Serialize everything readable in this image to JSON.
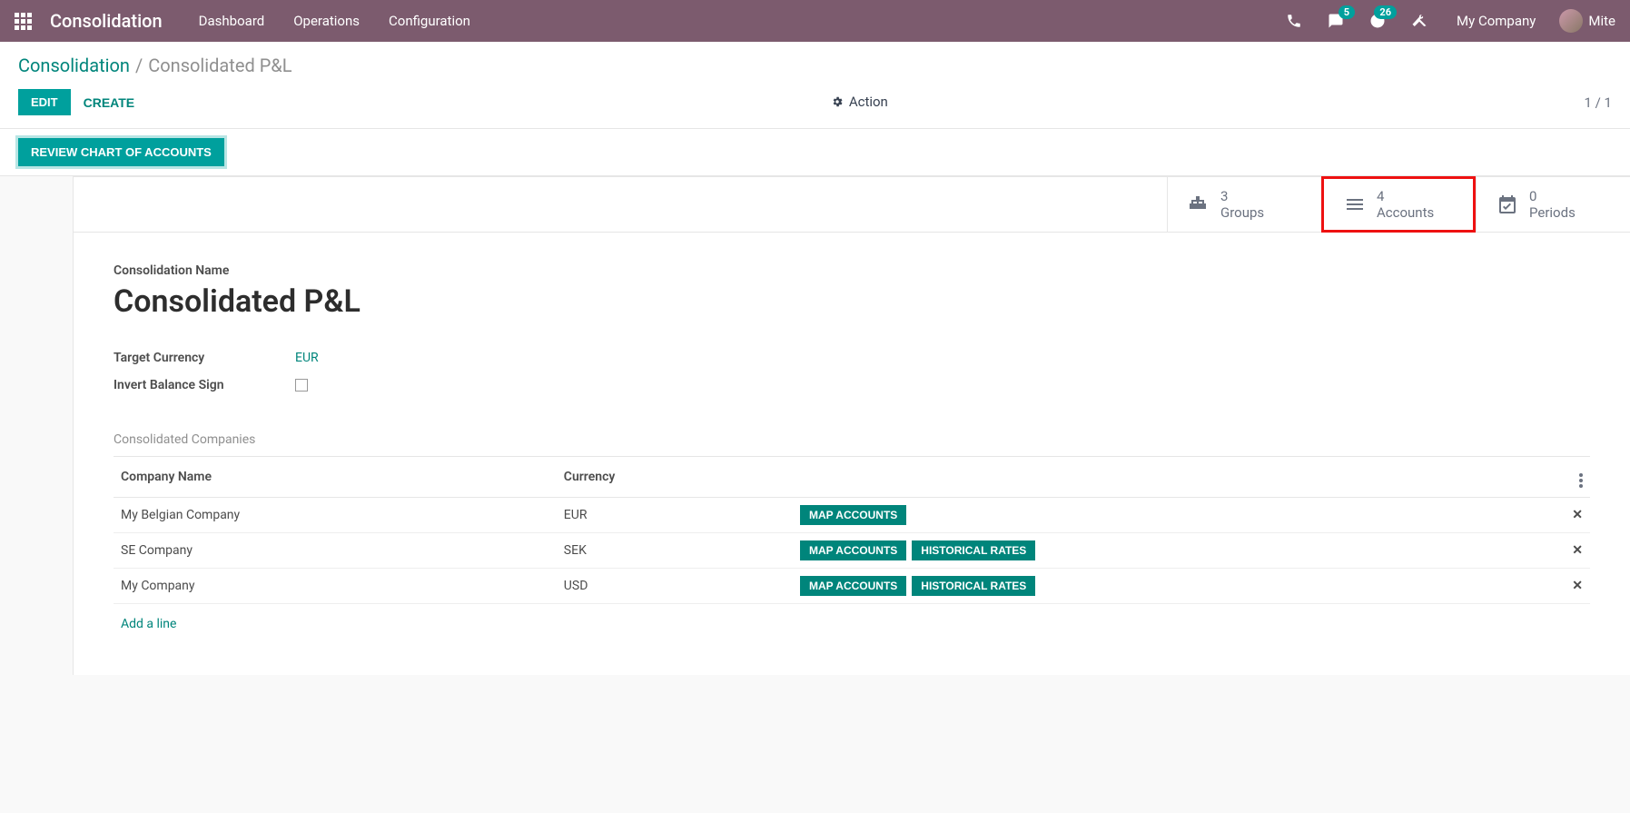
{
  "topnav": {
    "brand": "Consolidation",
    "links": [
      "Dashboard",
      "Operations",
      "Configuration"
    ],
    "msg_badge": "5",
    "activity_badge": "26",
    "company": "My Company",
    "username": "Mite"
  },
  "breadcrumb": {
    "root": "Consolidation",
    "sep": "/",
    "current": "Consolidated P&L"
  },
  "action_bar": {
    "edit": "EDIT",
    "create": "CREATE",
    "action": "Action",
    "pager": "1 / 1"
  },
  "status_bar": {
    "review": "REVIEW CHART OF ACCOUNTS"
  },
  "stats": {
    "groups": {
      "count": "3",
      "label": "Groups"
    },
    "accounts": {
      "count": "4",
      "label": "Accounts"
    },
    "periods": {
      "count": "0",
      "label": "Periods"
    }
  },
  "form": {
    "name_label": "Consolidation Name",
    "name": "Consolidated P&L",
    "currency_label": "Target Currency",
    "currency_value": "EUR",
    "invert_label": "Invert Balance Sign",
    "section_title": "Consolidated Companies",
    "col_company": "Company Name",
    "col_currency": "Currency",
    "rows": [
      {
        "name": "My Belgian Company",
        "currency": "EUR",
        "map": "MAP ACCOUNTS",
        "rates": null
      },
      {
        "name": "SE Company",
        "currency": "SEK",
        "map": "MAP ACCOUNTS",
        "rates": "HISTORICAL RATES"
      },
      {
        "name": "My Company",
        "currency": "USD",
        "map": "MAP ACCOUNTS",
        "rates": "HISTORICAL RATES"
      }
    ],
    "add_line": "Add a line"
  }
}
